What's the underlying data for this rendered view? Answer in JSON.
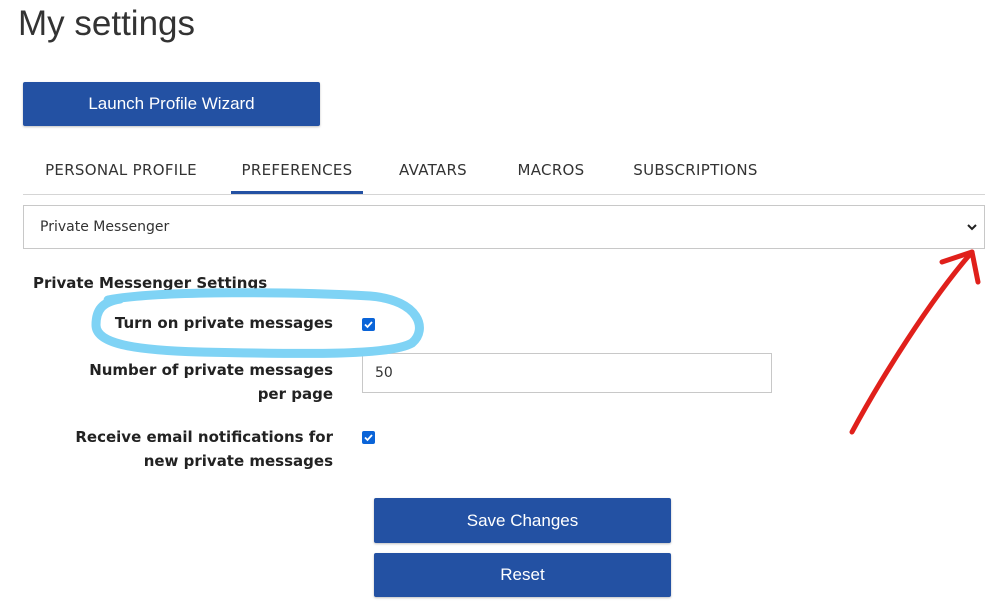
{
  "page": {
    "title": "My settings"
  },
  "wizard": {
    "label": "Launch Profile Wizard"
  },
  "tabs": [
    {
      "label": "PERSONAL PROFILE",
      "active": false
    },
    {
      "label": "PREFERENCES",
      "active": true
    },
    {
      "label": "AVATARS",
      "active": false
    },
    {
      "label": "MACROS",
      "active": false
    },
    {
      "label": "SUBSCRIPTIONS",
      "active": false
    }
  ],
  "category_select": {
    "value": "Private Messenger",
    "icon": "chevron-down-icon"
  },
  "settings": {
    "heading": "Private Messenger Settings",
    "turn_on_label": "Turn on private messages",
    "turn_on_checked": true,
    "per_page_label": "Number of private messages per page",
    "per_page_value": "50",
    "email_notify_label": "Receive email notifications for new private messages",
    "email_notify_checked": true
  },
  "actions": {
    "save_label": "Save Changes",
    "reset_label": "Reset"
  },
  "colors": {
    "primary": "#2351a3",
    "checkbox": "#0a64d8",
    "highlight_annotation": "#7fd3f5",
    "arrow_annotation": "#e0201b"
  }
}
